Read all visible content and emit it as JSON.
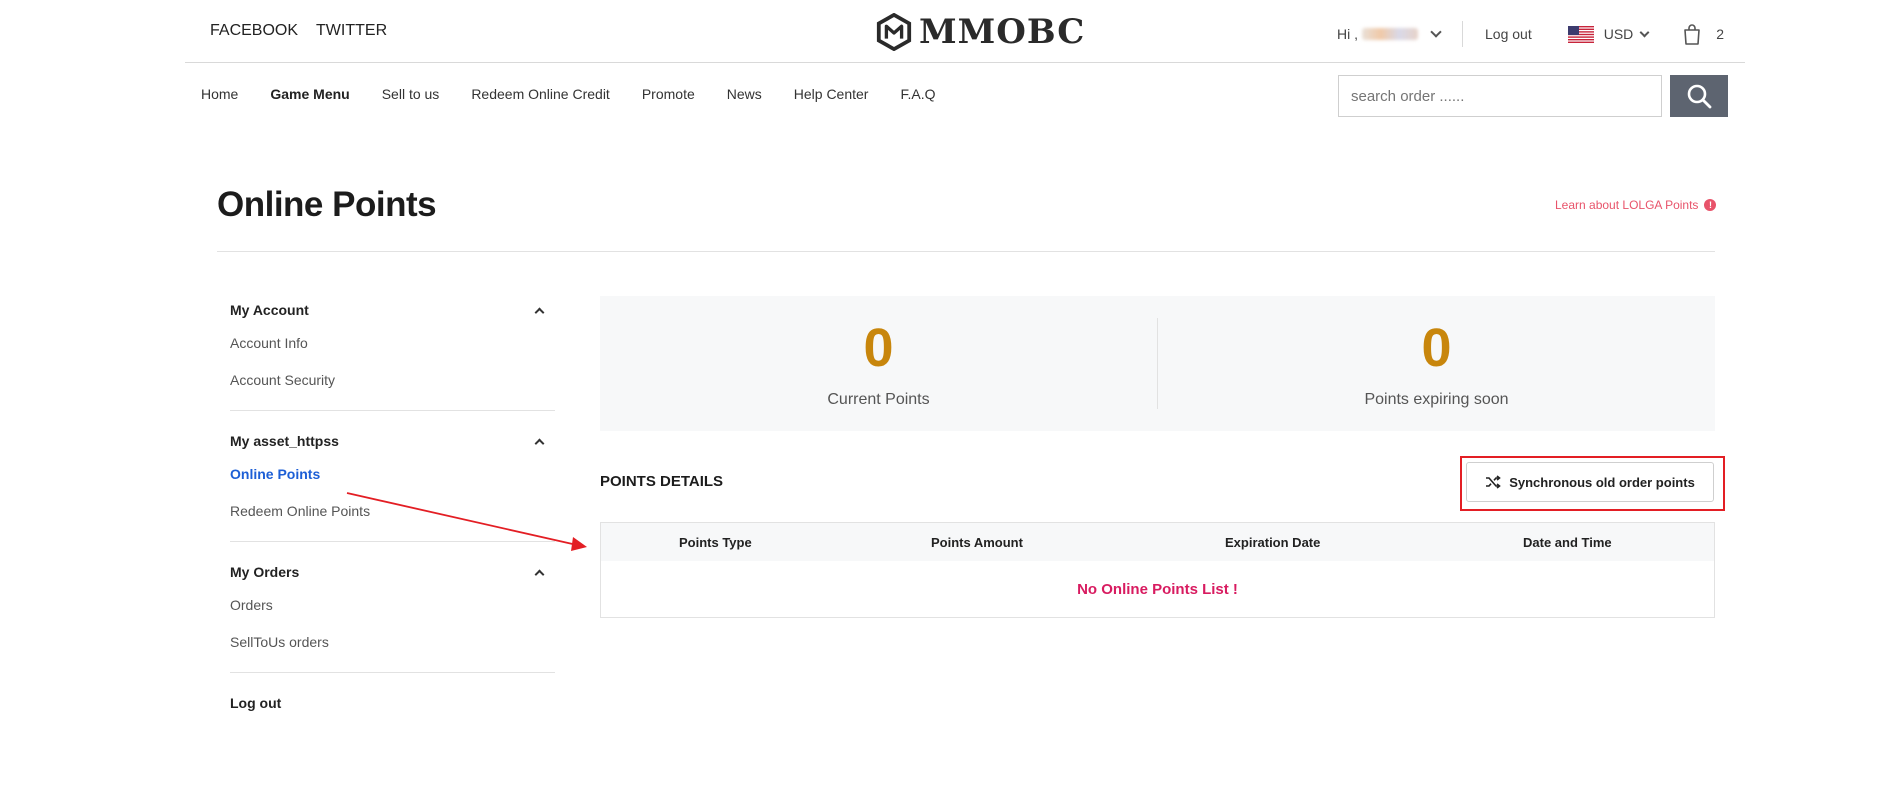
{
  "social": {
    "facebook": "FACEBOOK",
    "twitter": "TWITTER"
  },
  "brand": {
    "logo_text": "MMOBC",
    "logo_icon": "mmobc-logo-icon"
  },
  "user": {
    "greeting": "Hi ,",
    "logout": "Log out"
  },
  "currency": {
    "code": "USD",
    "flag": "us-flag-icon"
  },
  "cart": {
    "count": "2",
    "icon": "shopping-bag-icon"
  },
  "nav": {
    "items": [
      "Home",
      "Game Menu",
      "Sell to us",
      "Redeem Online Credit",
      "Promote",
      "News",
      "Help Center",
      "F.A.Q"
    ]
  },
  "search": {
    "placeholder": "search order ......",
    "icon": "search-icon"
  },
  "page": {
    "title": "Online Points",
    "learn_link": "Learn about LOLGA Points",
    "learn_badge": "!"
  },
  "sidebar": {
    "groups": [
      {
        "title": "My Account",
        "items": [
          "Account Info",
          "Account Security"
        ]
      },
      {
        "title": "My asset_httpss",
        "items": [
          "Online Points",
          "Redeem Online Points"
        ],
        "active": "Online Points"
      },
      {
        "title": "My Orders",
        "items": [
          "Orders",
          "SellToUs orders"
        ]
      }
    ],
    "logout": "Log out"
  },
  "stats": {
    "current": {
      "value": "0",
      "label": "Current Points"
    },
    "expiring": {
      "value": "0",
      "label": "Points expiring soon"
    }
  },
  "details": {
    "title": "POINTS DETAILS",
    "sync_button": "Synchronous old order points",
    "columns": [
      "Points Type",
      "Points Amount",
      "Expiration Date",
      "Date and Time"
    ],
    "empty_text": "No Online Points List !"
  },
  "colors": {
    "accent_gold": "#c8860c",
    "link_blue": "#1d5fd6",
    "empty_pink": "#d81b60",
    "learn_red": "#e8536a",
    "annotation_red": "#e31e24",
    "search_button": "#5d6470"
  }
}
